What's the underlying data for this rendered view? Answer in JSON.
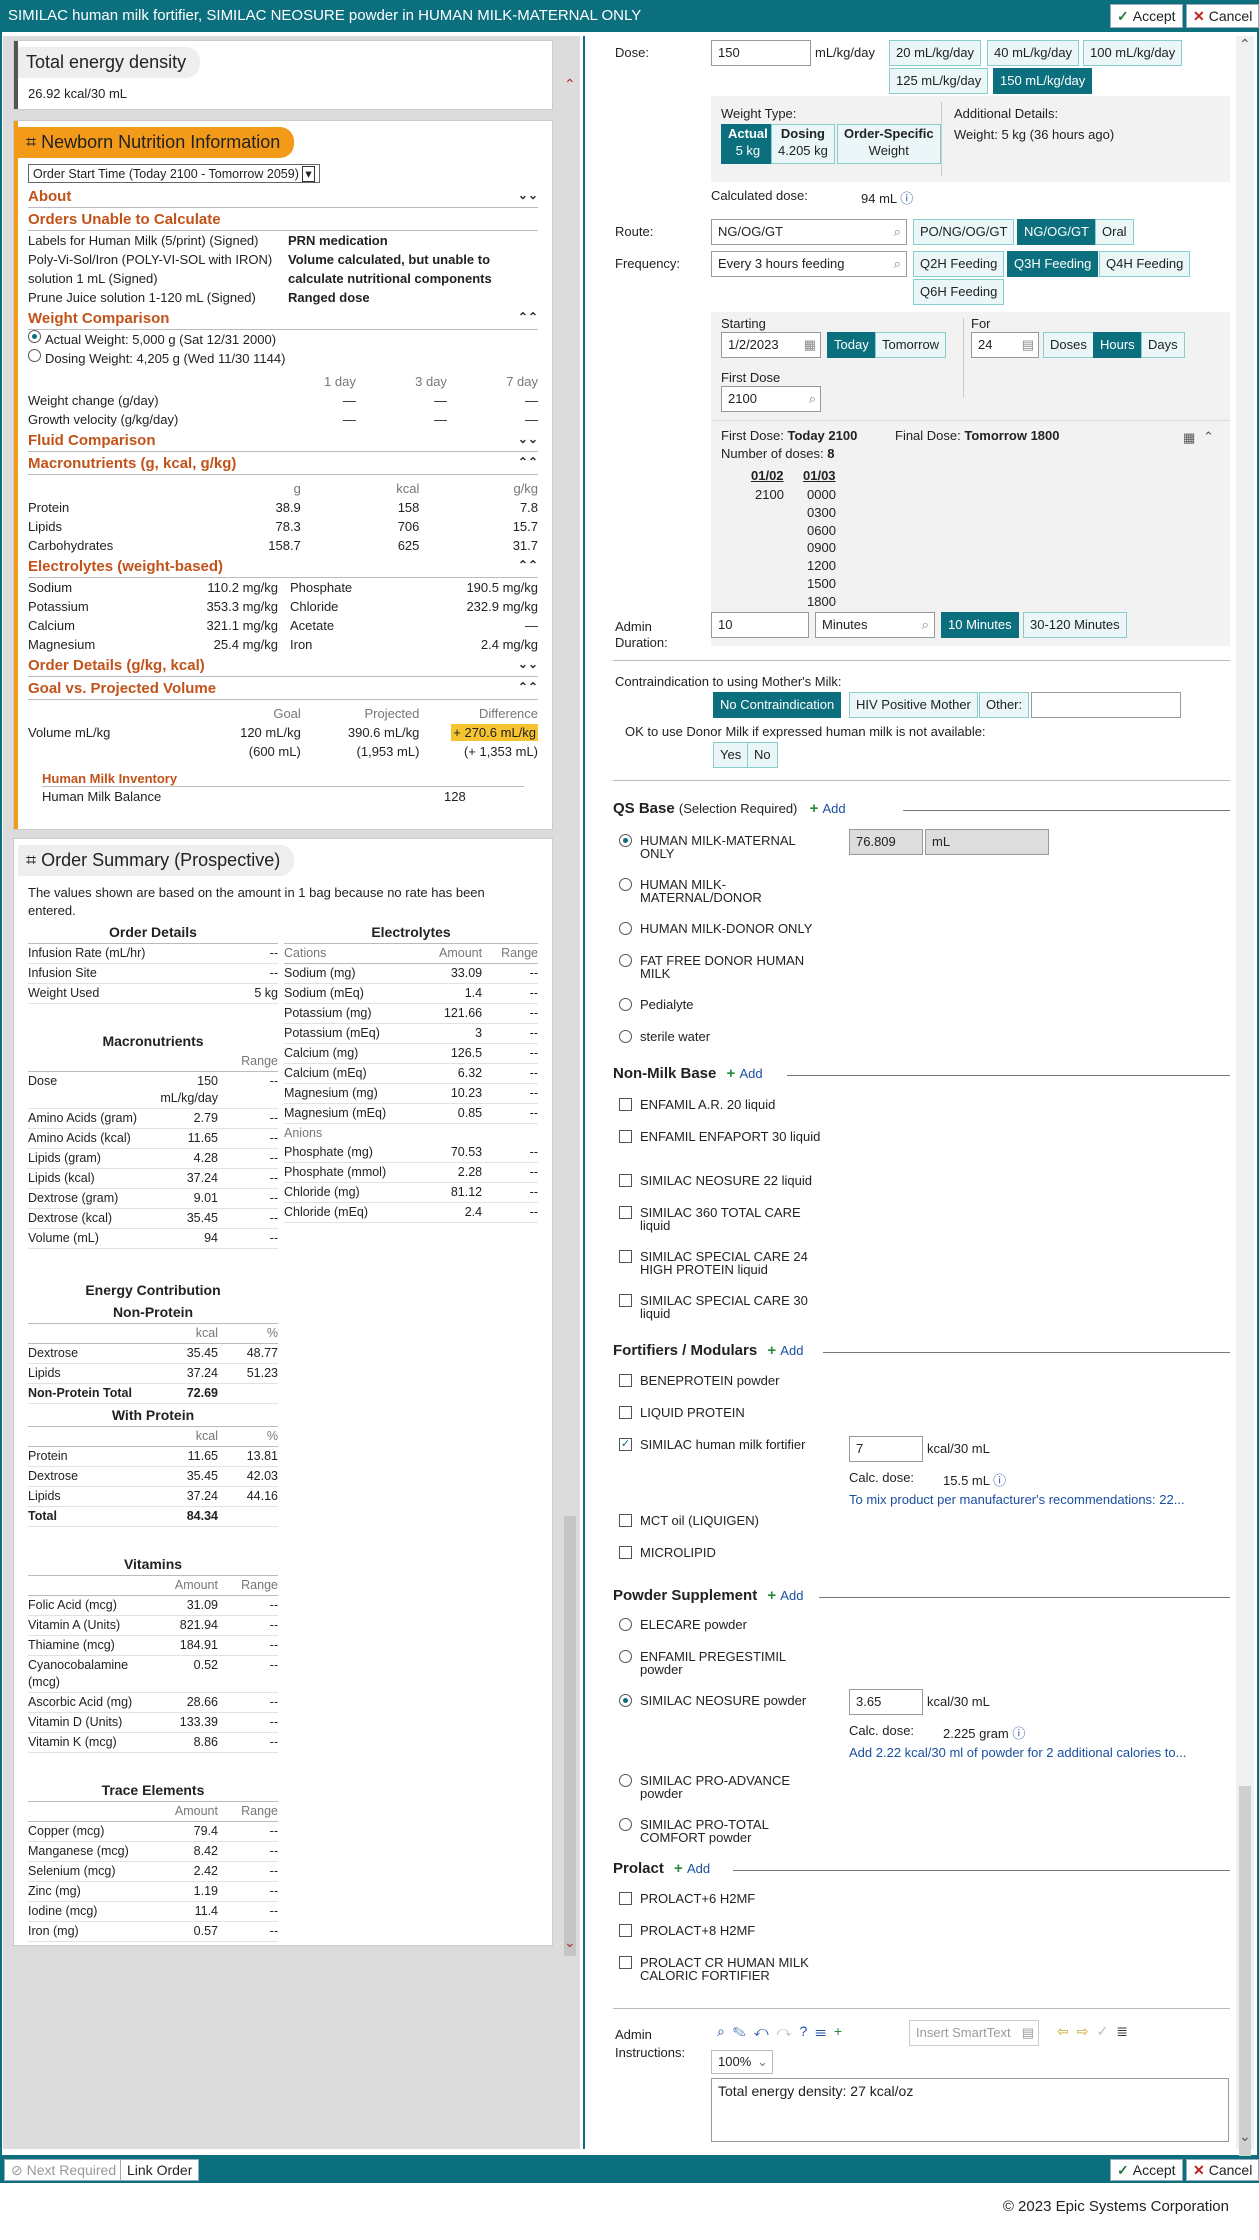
{
  "window": {
    "title": "SIMILAC human milk fortifier, SIMILAC NEOSURE powder in HUMAN MILK-MATERNAL ONLY",
    "accept": "Accept",
    "cancel": "Cancel"
  },
  "energy": {
    "title": "Total energy density",
    "value": "26.92 kcal/30 mL"
  },
  "nni": {
    "title": "Newborn Nutrition Information",
    "select": "Order Start Time (Today 2100 - Tomorrow 2059)",
    "about": "About",
    "unable": "Orders Unable to Calculate",
    "unable_rows": [
      [
        "Labels for Human Milk (5/print) (Signed)",
        "PRN medication"
      ],
      [
        "Poly-Vi-Sol/Iron (POLY-VI-SOL with IRON) solution 1 mL (Signed)",
        "Volume calculated, but unable to calculate nutritional components"
      ],
      [
        "Prune Juice solution 1-120 mL (Signed)",
        "Ranged dose"
      ]
    ],
    "weight_comp": "Weight Comparison",
    "actual_weight": "Actual Weight: 5,000 g (Sat 12/31 2000)",
    "dosing_weight": "Dosing Weight: 4,205 g (Wed 11/30 1144)",
    "wc_cols": [
      "1 day",
      "3 day",
      "7 day"
    ],
    "wc_rows": [
      [
        "Weight change (g/day)",
        "—",
        "—",
        "—"
      ],
      [
        "Growth velocity (g/kg/day)",
        "—",
        "—",
        "—"
      ]
    ],
    "fluid": "Fluid Comparison",
    "macro": "Macronutrients (g, kcal, g/kg)",
    "macro_cols": [
      "g",
      "kcal",
      "g/kg"
    ],
    "macro_rows": [
      [
        "Protein",
        "38.9",
        "158",
        "7.8"
      ],
      [
        "Lipids",
        "78.3",
        "706",
        "15.7"
      ],
      [
        "Carbohydrates",
        "158.7",
        "625",
        "31.7"
      ]
    ],
    "electro": "Electrolytes (weight-based)",
    "electro_rows": [
      [
        "Sodium",
        "110.2 mg/kg",
        "Phosphate",
        "190.5 mg/kg"
      ],
      [
        "Potassium",
        "353.3 mg/kg",
        "Chloride",
        "232.9 mg/kg"
      ],
      [
        "Calcium",
        "321.1 mg/kg",
        "Acetate",
        "—"
      ],
      [
        "Magnesium",
        "25.4 mg/kg",
        "Iron",
        "2.4 mg/kg"
      ]
    ],
    "order_details": "Order Details (g/kg, kcal)",
    "goal": "Goal vs. Projected Volume",
    "goal_cols": [
      "Goal",
      "Projected",
      "Difference"
    ],
    "vol_label": "Volume mL/kg",
    "goal_v": "120 mL/kg",
    "goal_v2": "(600 mL)",
    "proj_v": "390.6 mL/kg",
    "proj_v2": "(1,953 mL)",
    "diff_v": "+ 270.6 mL/kg",
    "diff_v2": "(+ 1,353 mL)",
    "inventory": "Human Milk Inventory",
    "balance_label": "Human Milk Balance",
    "balance": "128"
  },
  "summary": {
    "title": "Order Summary (Prospective)",
    "note": "The values shown are based on the amount in 1 bag because no rate has been entered.",
    "order_details": "Order Details",
    "od_rows": [
      [
        "Infusion Rate (mL/hr)",
        "--"
      ],
      [
        "Infusion Site",
        "--"
      ],
      [
        "Weight Used",
        "5 kg"
      ]
    ],
    "macronutrients": "Macronutrients",
    "range": "Range",
    "macro_rows": [
      [
        "Dose",
        "150 mL/kg/day",
        "--"
      ],
      [
        "Amino Acids (gram)",
        "2.79",
        "--"
      ],
      [
        "Amino Acids (kcal)",
        "11.65",
        "--"
      ],
      [
        "Lipids (gram)",
        "4.28",
        "--"
      ],
      [
        "Lipids (kcal)",
        "37.24",
        "--"
      ],
      [
        "Dextrose (gram)",
        "9.01",
        "--"
      ],
      [
        "Dextrose (kcal)",
        "35.45",
        "--"
      ],
      [
        "Volume (mL)",
        "94",
        "--"
      ]
    ],
    "electrolytes": "Electrolytes",
    "cations": "Cations",
    "amount": "Amount",
    "anions": "Anions",
    "cation_rows": [
      [
        "Sodium (mg)",
        "33.09",
        "--"
      ],
      [
        "Sodium (mEq)",
        "1.4",
        "--"
      ],
      [
        "Potassium (mg)",
        "121.66",
        "--"
      ],
      [
        "Potassium (mEq)",
        "3",
        "--"
      ],
      [
        "Calcium (mg)",
        "126.5",
        "--"
      ],
      [
        "Calcium (mEq)",
        "6.32",
        "--"
      ],
      [
        "Magnesium (mg)",
        "10.23",
        "--"
      ],
      [
        "Magnesium (mEq)",
        "0.85",
        "--"
      ]
    ],
    "anion_rows": [
      [
        "Phosphate (mg)",
        "70.53",
        "--"
      ],
      [
        "Phosphate (mmol)",
        "2.28",
        "--"
      ],
      [
        "Chloride (mg)",
        "81.12",
        "--"
      ],
      [
        "Chloride (mEq)",
        "2.4",
        "--"
      ]
    ],
    "energy": "Energy Contribution",
    "nonprotein": "Non-Protein",
    "kcal": "kcal",
    "pct": "%",
    "np_rows": [
      [
        "Dextrose",
        "35.45",
        "48.77"
      ],
      [
        "Lipids",
        "37.24",
        "51.23"
      ]
    ],
    "np_total": [
      "Non-Protein Total",
      "72.69",
      ""
    ],
    "withprotein": "With Protein",
    "wp_rows": [
      [
        "Protein",
        "11.65",
        "13.81"
      ],
      [
        "Dextrose",
        "35.45",
        "42.03"
      ],
      [
        "Lipids",
        "37.24",
        "44.16"
      ]
    ],
    "wp_total": [
      "Total",
      "84.34",
      ""
    ],
    "vitamins": "Vitamins",
    "vit_rows": [
      [
        "Folic Acid (mcg)",
        "31.09",
        "--"
      ],
      [
        "Vitamin A (Units)",
        "821.94",
        "--"
      ],
      [
        "Thiamine (mcg)",
        "184.91",
        "--"
      ],
      [
        "Cyanocobalamine (mcg)",
        "0.52",
        "--"
      ],
      [
        "Ascorbic Acid (mg)",
        "28.66",
        "--"
      ],
      [
        "Vitamin D (Units)",
        "133.39",
        "--"
      ],
      [
        "Vitamin K (mcg)",
        "8.86",
        "--"
      ]
    ],
    "trace": "Trace Elements",
    "trace_rows": [
      [
        "Copper (mcg)",
        "79.4",
        "--"
      ],
      [
        "Manganese (mcg)",
        "8.42",
        "--"
      ],
      [
        "Selenium (mcg)",
        "2.42",
        "--"
      ],
      [
        "Zinc (mg)",
        "1.19",
        "--"
      ],
      [
        "Iodine (mcg)",
        "11.4",
        "--"
      ],
      [
        "Iron (mg)",
        "0.57",
        "--"
      ]
    ]
  },
  "form": {
    "dose_label": "Dose:",
    "dose": "150",
    "dose_unit": "mL/kg/day",
    "dose_btns": [
      "20 mL/kg/day",
      "40 mL/kg/day",
      "100 mL/kg/day",
      "125 mL/kg/day",
      "150 mL/kg/day"
    ],
    "wt_type": "Weight Type:",
    "wt_actual": "Actual",
    "wt_actual_v": "5 kg",
    "wt_dosing": "Dosing",
    "wt_dosing_v": "4.205 kg",
    "wt_os": "Order-Specific",
    "wt_os_v": "Weight",
    "add_details": "Additional Details:",
    "add_weight": "Weight: 5 kg (36 hours ago)",
    "calc_label": "Calculated dose:",
    "calc": "94 mL",
    "route_label": "Route:",
    "route": "NG/OG/GT",
    "route_btns": [
      "PO/NG/OG/GT",
      "NG/OG/GT",
      "Oral"
    ],
    "freq_label": "Frequency:",
    "freq": "Every 3 hours feeding",
    "freq_btns": [
      "Q2H Feeding",
      "Q3H Feeding",
      "Q4H Feeding",
      "Q6H Feeding"
    ],
    "starting": "Starting",
    "start_date": "1/2/2023",
    "today": "Today",
    "tomorrow": "Tomorrow",
    "for": "For",
    "for_v": "24",
    "doses": "Doses",
    "hours": "Hours",
    "days": "Days",
    "first_dose_label": "First Dose",
    "first_dose": "2100",
    "fd_l": "First Dose:",
    "fd_v": "Today 2100",
    "ld_l": "Final Dose:",
    "ld_v": "Tomorrow 1800",
    "nd_l": "Number of doses:",
    "nd_v": "8",
    "d1": "01/02",
    "d1_times": [
      "2100"
    ],
    "d2": "01/03",
    "d2_times": [
      "0000",
      "0300",
      "0600",
      "0900",
      "1200",
      "1500",
      "1800"
    ],
    "admin_dur": "Admin Duration:",
    "dur": "10",
    "dur_unit": "Minutes",
    "dur_btns": [
      "10 Minutes",
      "30-120 Minutes"
    ],
    "contra_label": "Contraindication to using Mother's Milk:",
    "contra_btns": [
      "No Contraindication",
      "HIV Positive Mother",
      "Other:"
    ],
    "donor_q": "OK to use Donor Milk if expressed human milk is not available:",
    "yes": "Yes",
    "no": "No",
    "qs": "QS Base",
    "qs_req": "(Selection Required)",
    "add": "Add",
    "qs_vol": "76.809",
    "qs_unit": "mL",
    "qs_items": [
      "HUMAN MILK-MATERNAL ONLY",
      "HUMAN MILK-MATERNAL/DONOR",
      "HUMAN MILK-DONOR ONLY",
      "FAT FREE DONOR HUMAN MILK",
      "Pedialyte",
      "sterile water"
    ],
    "nonmilk": "Non-Milk Base",
    "nonmilk_items": [
      "ENFAMIL A.R. 20 liquid",
      "ENFAMIL ENFAPORT 30 liquid",
      "SIMILAC NEOSURE 22 liquid",
      "SIMILAC 360 TOTAL CARE liquid",
      "SIMILAC SPECIAL CARE 24 HIGH PROTEIN liquid",
      "SIMILAC SPECIAL CARE 30 liquid"
    ],
    "fort": "Fortifiers / Modulars",
    "fort_items": [
      "BENEPROTEIN powder",
      "LIQUID PROTEIN",
      "SIMILAC human milk fortifier",
      "MCT oil (LIQUIGEN)",
      "MICROLIPID"
    ],
    "fort_v": "7",
    "fort_unit": "kcal/30 mL",
    "calc_dose": "Calc. dose:",
    "fort_calc": "15.5 mL",
    "fort_link": "To mix product per manufacturer's recommendations: 22...",
    "powder": "Powder Supplement",
    "powder_items": [
      "ELECARE powder",
      "ENFAMIL PREGESTIMIL powder",
      "SIMILAC NEOSURE powder",
      "SIMILAC PRO-ADVANCE powder",
      "SIMILAC PRO-TOTAL COMFORT powder"
    ],
    "powder_v": "3.65",
    "powder_unit": "kcal/30 mL",
    "powder_calc": "2.225 gram",
    "powder_link": "Add 2.22 kcal/30 ml of powder for 2 additional calories to...",
    "prolact": "Prolact",
    "prolact_items": [
      "PROLACT+6 H2MF",
      "PROLACT+8 H2MF",
      "PROLACT CR HUMAN MILK CALORIC FORTIFIER"
    ],
    "admin_instr": "Admin Instructions:",
    "smarttext": "Insert SmartText",
    "zoom": "100%",
    "instr": "Total energy density: 27 kcal/oz"
  },
  "bottom": {
    "next": "Next Required",
    "link": "Link Order",
    "accept": "Accept",
    "cancel": "Cancel"
  },
  "footer": "© 2023 Epic Systems Corporation"
}
